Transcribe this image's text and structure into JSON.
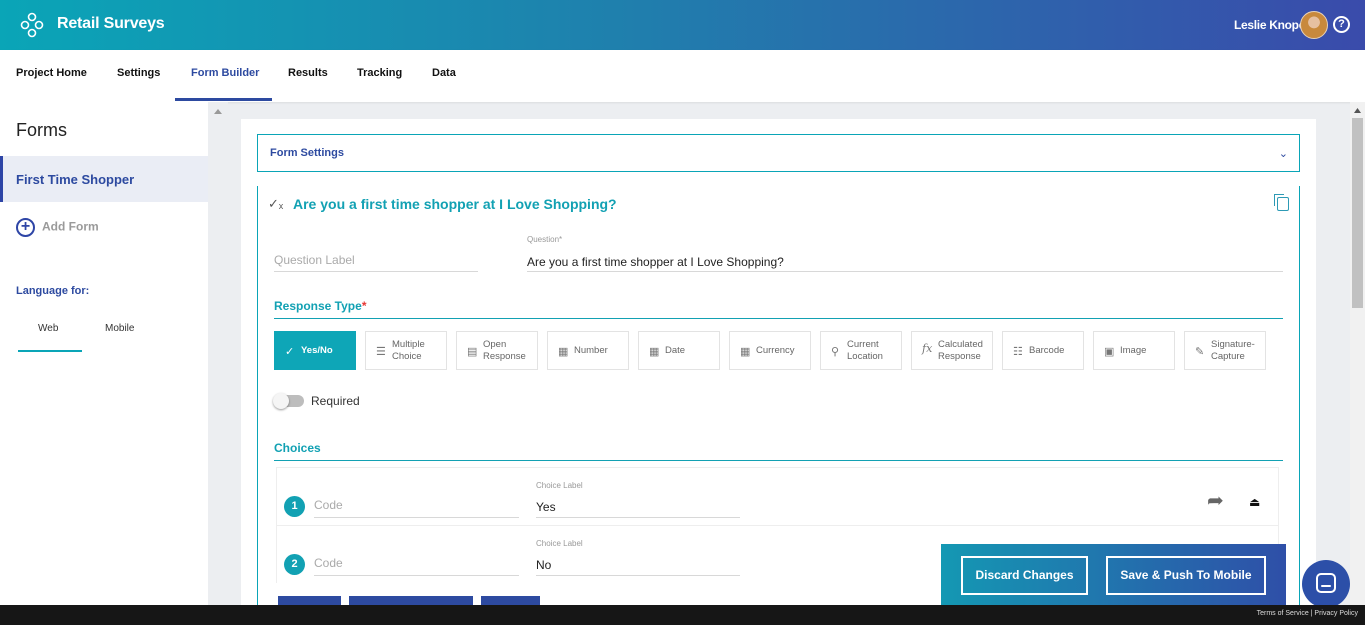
{
  "app": {
    "title": "Retail Surveys",
    "user_name": "Leslie Knope",
    "help_symbol": "?"
  },
  "nav": {
    "tabs": [
      "Project Home",
      "Settings",
      "Form Builder",
      "Results",
      "Tracking",
      "Data"
    ],
    "active": "Form Builder"
  },
  "sidebar": {
    "heading": "Forms",
    "forms": [
      "First Time Shopper"
    ],
    "add_form": "Add Form",
    "language_label": "Language for:",
    "language_tabs": [
      "Web",
      "Mobile"
    ]
  },
  "form_settings": {
    "label": "Form Settings"
  },
  "question": {
    "title": "Are you a first time shopper at I Love Shopping?",
    "label_placeholder": "Question Label",
    "question_caption": "Question*",
    "question_value": "Are you a first time shopper at I Love Shopping?"
  },
  "response_type": {
    "heading": "Response Type",
    "required_mark": "*",
    "options": [
      {
        "label": "Yes/No",
        "icon": "check-x-icon",
        "active": true
      },
      {
        "label": "Multiple Choice",
        "icon": "list-icon",
        "active": false
      },
      {
        "label": "Open Response",
        "icon": "text-box-icon",
        "active": false
      },
      {
        "label": "Number",
        "icon": "calculator-icon",
        "active": false
      },
      {
        "label": "Date",
        "icon": "calendar-icon",
        "active": false
      },
      {
        "label": "Currency",
        "icon": "calculator-icon",
        "active": false
      },
      {
        "label": "Current Location",
        "icon": "location-pin-icon",
        "active": false
      },
      {
        "label": "Calculated Response",
        "icon": "fx-icon",
        "active": false
      },
      {
        "label": "Barcode",
        "icon": "barcode-icon",
        "active": false
      },
      {
        "label": "Image",
        "icon": "camera-icon",
        "active": false
      },
      {
        "label": "Signature-Capture",
        "icon": "pen-icon",
        "active": false
      }
    ]
  },
  "required": {
    "label": "Required",
    "on": false
  },
  "choices": {
    "heading": "Choices",
    "code_placeholder": "Code",
    "caption": "Choice Label",
    "items": [
      {
        "num": "1",
        "label": "Yes"
      },
      {
        "num": "2",
        "label": "No"
      }
    ]
  },
  "actions": {
    "discard": "Discard Changes",
    "save": "Save & Push To Mobile"
  },
  "footer": {
    "text": "Terms of Service | Privacy Policy"
  },
  "colors": {
    "accent": "#12a1b3",
    "brand": "#2d4aa0"
  }
}
